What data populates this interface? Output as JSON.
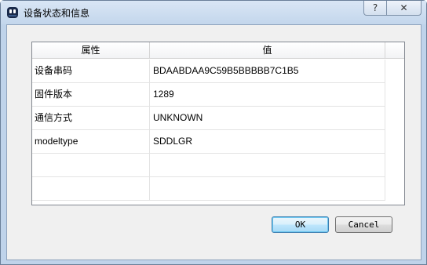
{
  "window": {
    "title": "设备状态和信息",
    "help_label": "?",
    "close_label": "✕"
  },
  "table": {
    "headers": [
      "属性",
      "值"
    ],
    "rows": [
      [
        "设备串码",
        "BDAABDAA9C59B5BBBBB7C1B5"
      ],
      [
        "固件版本",
        "1289"
      ],
      [
        "通信方式",
        "UNKNOWN"
      ],
      [
        "modeltype",
        "SDDLGR"
      ],
      [
        "",
        ""
      ],
      [
        "",
        ""
      ]
    ]
  },
  "buttons": {
    "ok_label": "OK",
    "cancel_label": "Cancel"
  },
  "icons": {
    "app": "app-icon",
    "help": "question-icon",
    "close": "close-icon"
  },
  "colors": {
    "titlebar": "#c3d6ec",
    "client_bg": "#f0f0f0",
    "ok_border": "#3c7fb1"
  }
}
